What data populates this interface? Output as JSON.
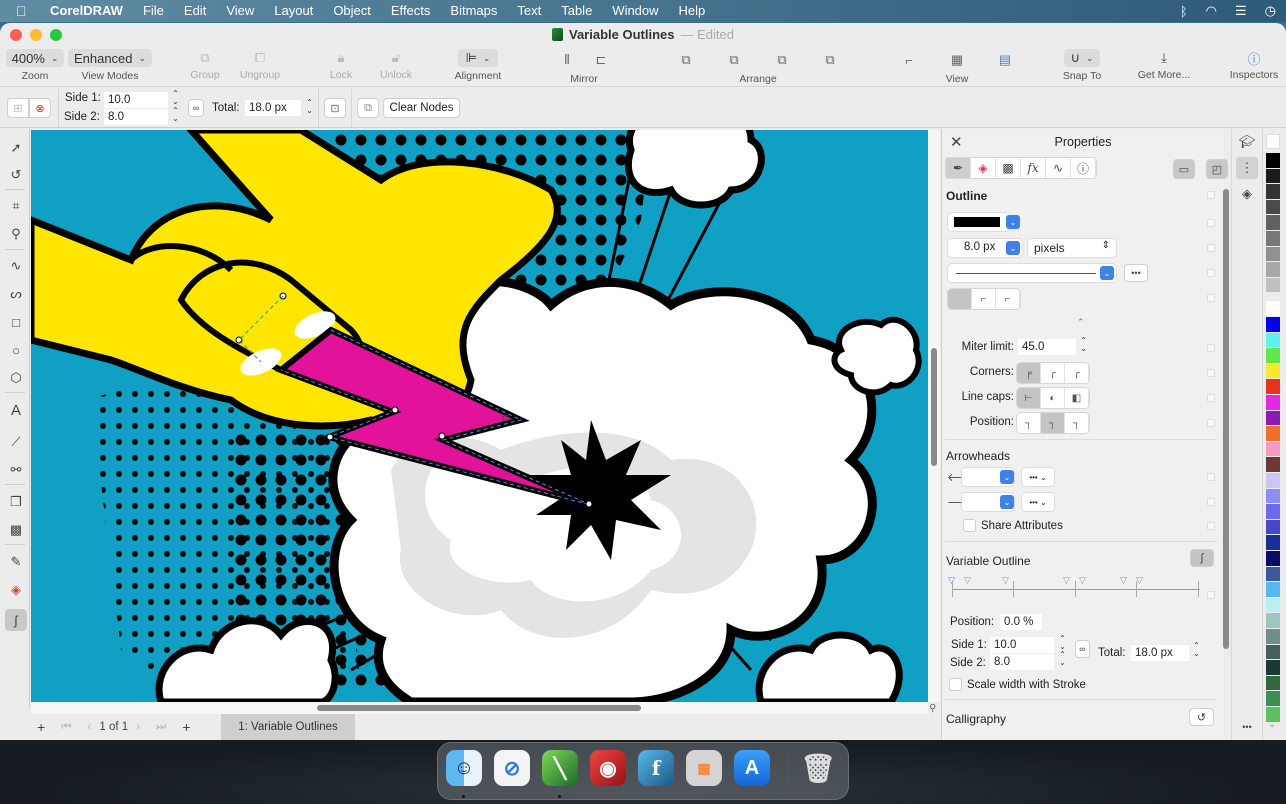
{
  "menubar": {
    "app_name": "CorelDRAW",
    "items": [
      "File",
      "Edit",
      "View",
      "Layout",
      "Object",
      "Effects",
      "Bitmaps",
      "Text",
      "Table",
      "Window",
      "Help"
    ],
    "status_icons": [
      "bluetooth-icon",
      "wifi-icon",
      "control-center-icon",
      "clock-icon"
    ]
  },
  "window": {
    "title": "Variable Outlines",
    "title_status": "— Edited"
  },
  "toolbar": {
    "zoom_value": "400%",
    "zoom_label": "Zoom",
    "view_mode_value": "Enhanced",
    "view_mode_label": "View Modes",
    "group_label": "Group",
    "ungroup_label": "Ungroup",
    "lock_label": "Lock",
    "unlock_label": "Unlock",
    "alignment_label": "Alignment",
    "mirror_label": "Mirror",
    "arrange_label": "Arrange",
    "view_label": "View",
    "snap_label": "Snap To",
    "getmore_label": "Get More...",
    "inspectors_label": "Inspectors"
  },
  "propbar": {
    "side1_label": "Side 1:",
    "side1_value": "10.0",
    "side2_label": "Side 2:",
    "side2_value": "8.0",
    "total_label": "Total:",
    "total_value": "18.0 px",
    "clear_nodes_label": "Clear Nodes"
  },
  "toolbox": {
    "tools": [
      "pick-tool",
      "shape-tool",
      "crop-tool",
      "zoom-tool",
      "freehand-tool",
      "artistic-media-tool",
      "rectangle-tool",
      "ellipse-tool",
      "polygon-tool",
      "text-tool",
      "dimension-tool",
      "connector-tool",
      "drop-shadow-tool",
      "transparency-tool",
      "eyedropper-tool",
      "interactive-fill-tool",
      "variable-outline-tool"
    ],
    "active": "variable-outline-tool"
  },
  "pagebar": {
    "page_current": "1",
    "page_of": "of",
    "page_total": "1",
    "page_tab": "1: Variable Outlines"
  },
  "properties": {
    "title": "Properties",
    "outline_heading": "Outline",
    "outline_color": "#000000",
    "width_value": "8.0 px",
    "units_value": "pixels",
    "miter_label": "Miter limit:",
    "miter_value": "45.0",
    "corners_label": "Corners:",
    "linecaps_label": "Line caps:",
    "position_label": "Position:",
    "arrowheads_heading": "Arrowheads",
    "share_attributes_label": "Share Attributes",
    "variable_outline_heading": "Variable Outline",
    "vo_position_label": "Position:",
    "vo_position_value": "0.0 %",
    "vo_side1_label": "Side 1:",
    "vo_side1_value": "10.0",
    "vo_side2_label": "Side 2:",
    "vo_side2_value": "8.0",
    "vo_total_label": "Total:",
    "vo_total_value": "18.0 px",
    "scale_width_label": "Scale width with Stroke",
    "calligraphy_heading": "Calligraphy",
    "more_label": "•••"
  },
  "palette": {
    "colors": [
      "#000000",
      "#1c1c1c",
      "#333333",
      "#4a4a4a",
      "#606060",
      "#787878",
      "#909090",
      "#a8a8a8",
      "#c0c0c0",
      "#ffffff",
      "#0000ee",
      "#5ff0f0",
      "#5ee84a",
      "#f7ea2c",
      "#e8321e",
      "#e628e6",
      "#8c1ab4",
      "#ef6e28",
      "#f59ac0",
      "#6a3a32",
      "#c9c6f0",
      "#8e8ef2",
      "#6a6aec",
      "#4848c6",
      "#1a2e96",
      "#0b0b66",
      "#3a5a9e",
      "#56b8f2",
      "#b6f0f0",
      "#9ec6c0",
      "#6e908c",
      "#44605c",
      "#1a3a36",
      "#2e6a3e",
      "#3e8e52",
      "#5cc05e"
    ]
  },
  "dock": {
    "apps": [
      "Finder",
      "Safari",
      "CorelDRAW",
      "Photo Booth",
      "Font Manager",
      "Launchpad",
      "App Store",
      "Trash"
    ]
  },
  "colors": {
    "canvas_bg": "#0fa0c4",
    "yellow": "#ffe600",
    "magenta": "#e2129a"
  }
}
